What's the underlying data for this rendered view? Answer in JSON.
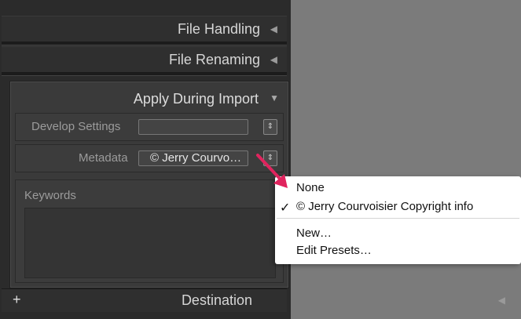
{
  "sections": {
    "file_handling": "File Handling",
    "file_renaming": "File Renaming",
    "apply_during_import": "Apply During Import",
    "destination": "Destination"
  },
  "apply": {
    "develop_settings_label": "Develop Settings",
    "develop_settings_value": "",
    "metadata_label": "Metadata",
    "metadata_value": "© Jerry Courvo…",
    "keywords_label": "Keywords"
  },
  "popup": {
    "items": [
      {
        "label": "None",
        "checked": false
      },
      {
        "label": "© Jerry Courvoisier Copyright info",
        "checked": true
      },
      {
        "label": "New…",
        "checked": false
      },
      {
        "label": "Edit Presets…",
        "checked": false
      }
    ],
    "check_glyph": "✓"
  },
  "glyphs": {
    "collapsed_triangle": "◀",
    "expanded_triangle": "▼",
    "select_arrows": "⇕",
    "plus": "+"
  },
  "colors": {
    "panel_bg": "#2b2b2b",
    "canvas_gray": "#7b7b7b",
    "arrow_red": "#e0245e"
  }
}
